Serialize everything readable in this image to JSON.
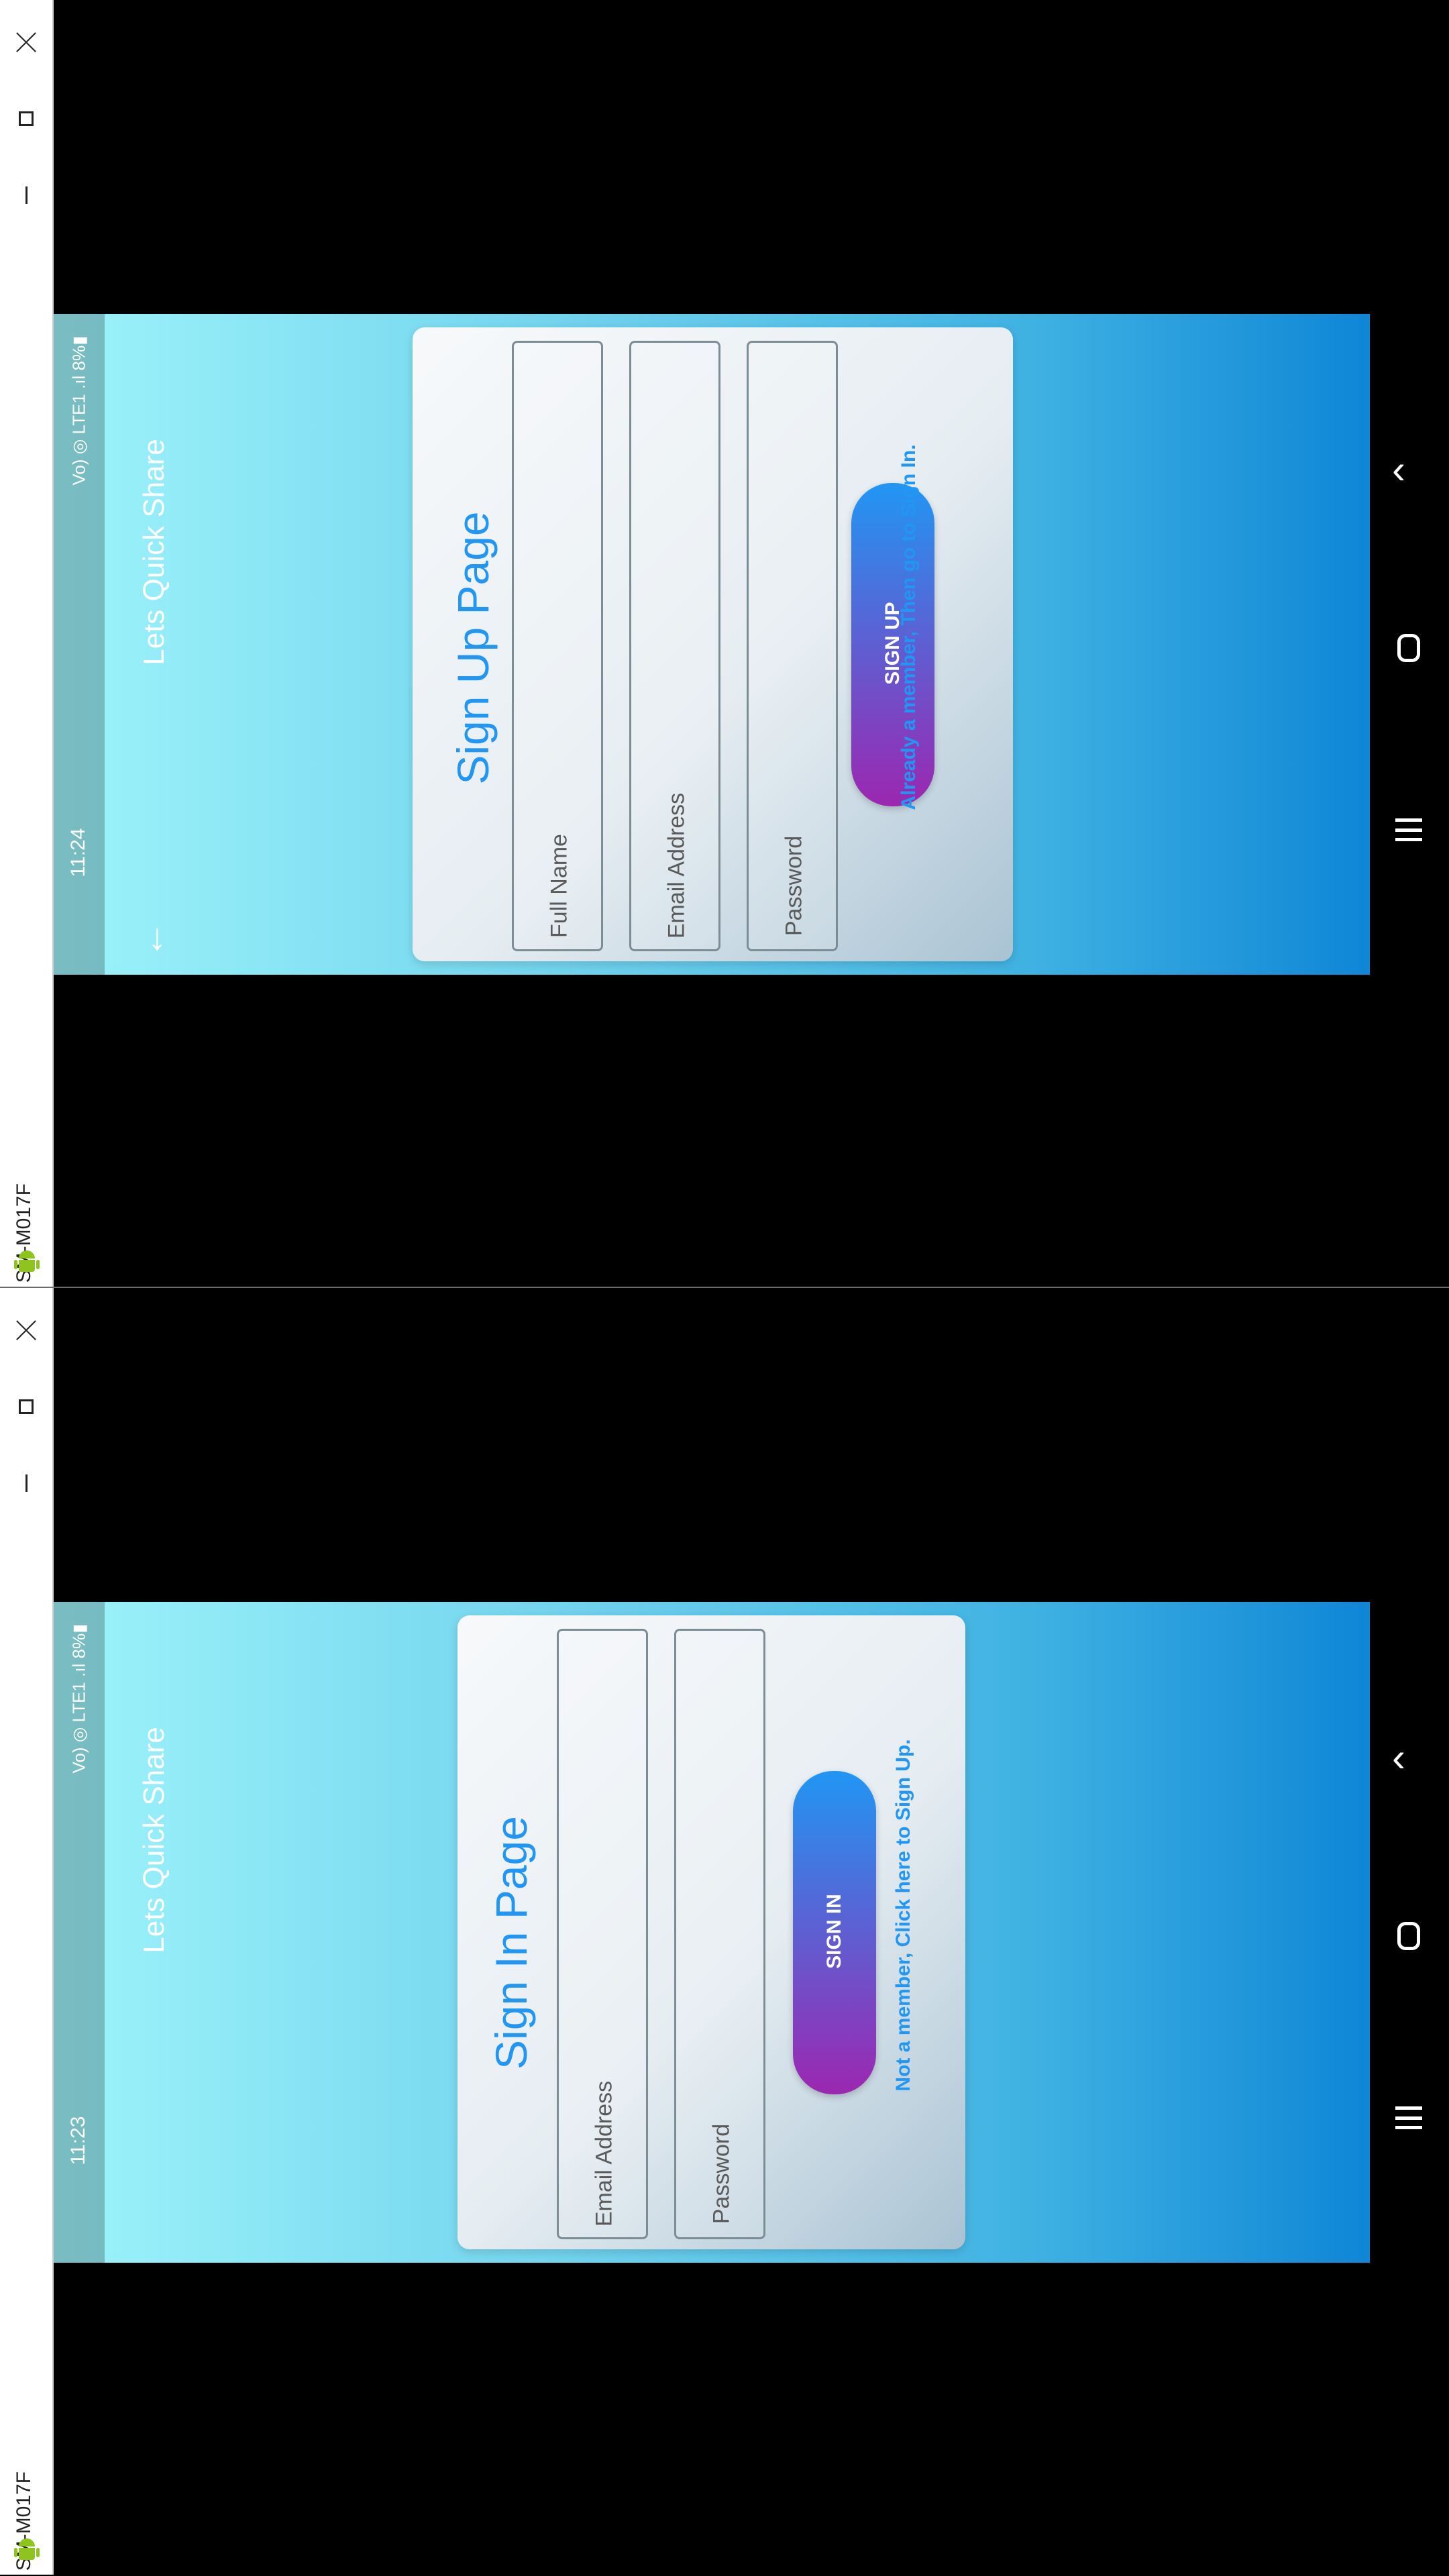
{
  "windows": [
    {
      "device_name": "SM-M017F",
      "status": {
        "time": "11:24",
        "icons": "Vo) ◎ LTE1 .ıl 8%▮"
      },
      "app_title": "Lets Quick Share",
      "page_title": "Sign Up Page",
      "fields": [
        "Full Name",
        "Email Address",
        "Password"
      ],
      "button": "SIGN UP",
      "link": "Already a member, Then go to Sign In."
    },
    {
      "device_name": "SM-M017F",
      "status": {
        "time": "11:23",
        "icons": "Vo) ◎ LTE1 .ıl 8%▮"
      },
      "app_title": "Lets Quick Share",
      "page_title": "Sign In Page",
      "fields": [
        "Email Address",
        "Password"
      ],
      "button": "SIGN IN",
      "link": "Not a member, Click here to Sign Up."
    }
  ]
}
